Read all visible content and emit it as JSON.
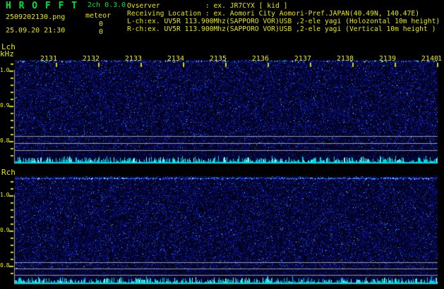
{
  "header": {
    "app_title": "H R O F F T",
    "version": "2ch 0.3.0",
    "filename": "2509202130.png",
    "mode": "meteor",
    "count_l": "0",
    "count_r": "0",
    "datetime": "25.09.20 21:30",
    "observer_line": "Ovserver           : ex. JR7CYX [ kid ]",
    "location_line": "Receiving Location : ex. Aomori City Aomori-Pref.JAPAN(40.49N, 140.47E)",
    "lch_config_line": "L-ch:ex. UV5R 113.900Mhz(SAPPORO VOR)USB ,2-ele yagi (Holozontal 10m height)",
    "rch_config_line": "R-ch:ex. UV5R 113.900Mhz(SAPPORO VOR)USB ,2-ele yagi (Vertical 10m height )"
  },
  "lch_panel": {
    "label": "Lch",
    "unit": "kHz",
    "freq_labels": [
      "1.0",
      "0.9",
      "0.8"
    ]
  },
  "rch_panel": {
    "label": "Rch",
    "freq_labels": [
      "1.0",
      "0.9",
      "0.8"
    ]
  },
  "time_axis": {
    "labels": [
      "2131",
      "2132",
      "2133",
      "2134",
      "2135",
      "2136",
      "2137",
      "2138",
      "2139",
      "2140"
    ],
    "partial_label": "1"
  },
  "colors": {
    "text_yellow": "#e8e800",
    "text_green": "#00e33c",
    "tick_yellow": "#d8d800",
    "grid_gray": "#9b9b9b",
    "axis_gray": "#a8a8a8",
    "band_cyan": "#00d7e0",
    "band_cyan_bright": "#8cfaff",
    "carrier_blue": "#2446f5",
    "carrier_cyan": "#46c8ff",
    "background": "#000000"
  }
}
